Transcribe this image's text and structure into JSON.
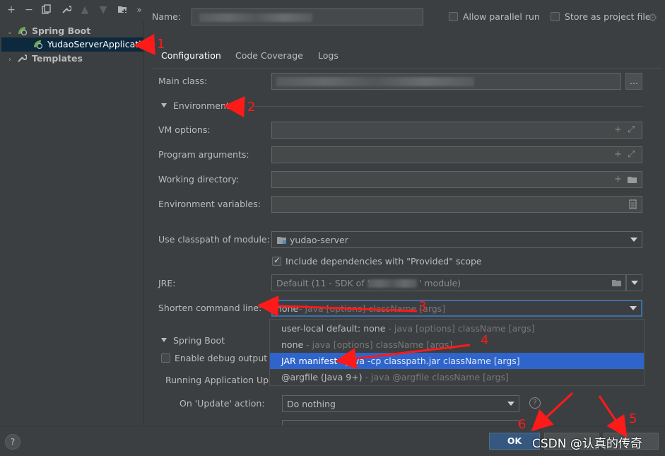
{
  "toolbar": {
    "icons": [
      "plus-icon",
      "minus-icon",
      "copy-icon",
      "wrench-icon",
      "arrow-up-icon",
      "arrow-down-icon",
      "folder-plus-icon",
      "more-icon"
    ]
  },
  "tree": {
    "spring_boot": "Spring Boot",
    "app": "YudaoServerApplication",
    "templates": "Templates"
  },
  "header": {
    "name_label": "Name:",
    "allow_parallel": "Allow parallel run",
    "store_project_file": "Store as project file"
  },
  "tabs": [
    "Configuration",
    "Code Coverage",
    "Logs"
  ],
  "form": {
    "main_class_label": "Main class:",
    "browse_label": "...",
    "environment_label": "Environment",
    "vm_options_label": "VM options:",
    "program_args_label": "Program arguments:",
    "working_dir_label": "Working directory:",
    "env_vars_label": "Environment variables:",
    "classpath_label": "Use classpath of module:",
    "classpath_value": "yudao-server",
    "include_deps_label": "Include dependencies with \"Provided\" scope",
    "jre_label": "JRE:",
    "jre_value_prefix": "Default (11 - SDK of '",
    "jre_value_suffix": "' module)",
    "shorten_label": "Shorten command line:",
    "shorten_value": "none",
    "shorten_hint": " - java [options] className [args]",
    "spring_boot_label": "Spring Boot",
    "debug_output_label": "Enable debug output",
    "running_app_label": "Running Application Upd",
    "on_update_label": "On 'Update' action:",
    "on_update_value": "Do nothing"
  },
  "dropdown": [
    {
      "main": "user-local default: none",
      "hint": " - java [options] className [args]"
    },
    {
      "main": "none",
      "hint": " - java [options] className [args]"
    },
    {
      "main": "JAR manifest",
      "hint": " - java -cp classpath.jar className [args]"
    },
    {
      "main": "@argfile (Java 9+)",
      "hint": " - java @argfile className [args]"
    }
  ],
  "footer": {
    "help": "?",
    "ok": "OK",
    "watermark": "CSDN @认真的传奇"
  },
  "annotations": [
    "1",
    "2",
    "3",
    "4",
    "5",
    "6"
  ],
  "colors": {
    "accent": "#4a88c7",
    "selection": "#2f65ca",
    "annotation": "#ff1a1a",
    "background": "#3c3f41"
  }
}
